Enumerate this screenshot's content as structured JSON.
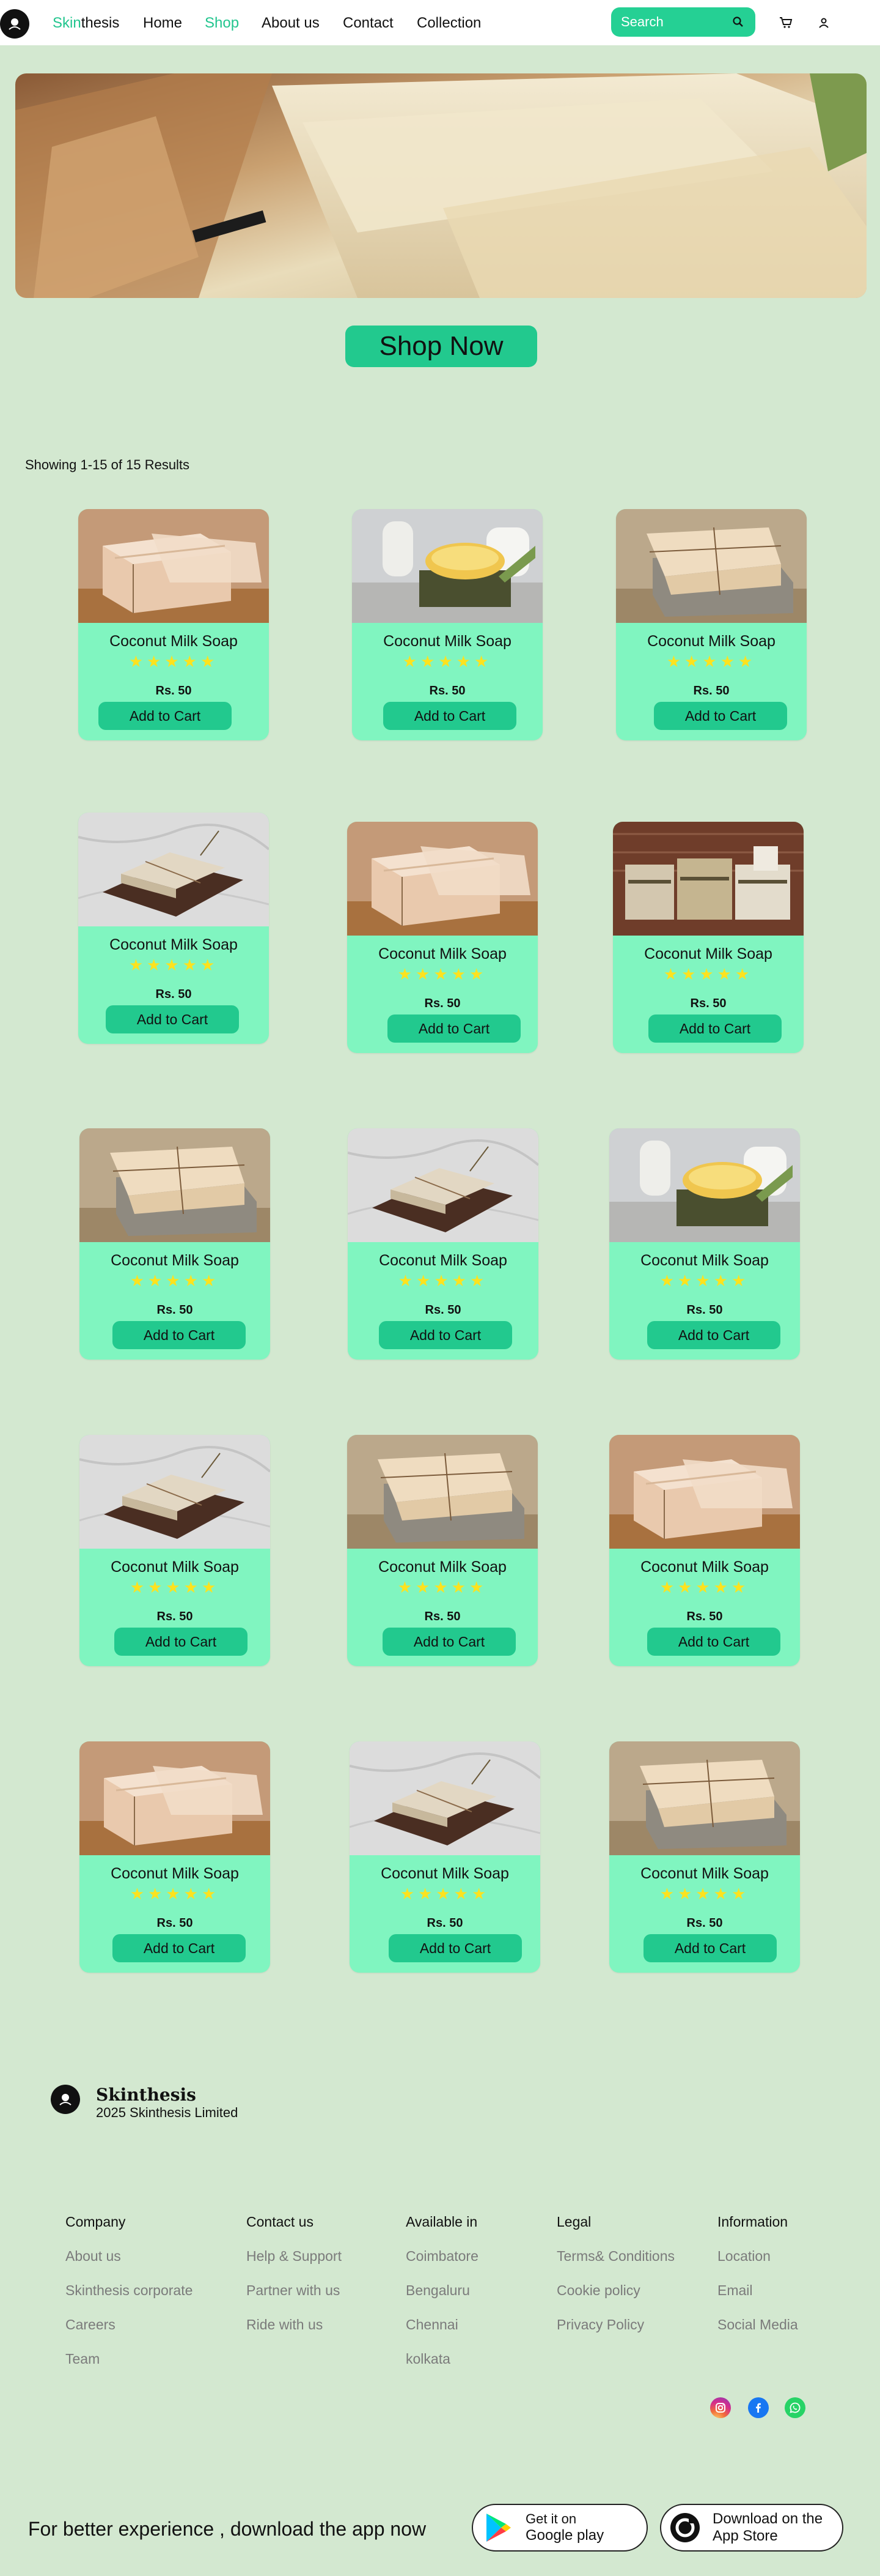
{
  "nav": {
    "brand_part1": "Skin",
    "brand_part2": "thesis",
    "links": [
      "Home",
      "Shop",
      "About us",
      "Contact",
      "Collection"
    ],
    "active": "Shop",
    "search_placeholder": "Search"
  },
  "hero": {
    "cta": "Shop Now"
  },
  "results_text": "Showing 1-15 of 15 Results",
  "products": [
    {
      "title": "Coconut Milk Soap",
      "rating": 5,
      "price": "Rs. 50",
      "button": "Add to Cart"
    },
    {
      "title": "Coconut Milk Soap",
      "rating": 5,
      "price": "Rs. 50",
      "button": "Add to Cart"
    },
    {
      "title": "Coconut Milk Soap",
      "rating": 5,
      "price": "Rs. 50",
      "button": "Add to Cart"
    },
    {
      "title": "Coconut Milk Soap",
      "rating": 5,
      "price": "Rs. 50",
      "button": "Add to Cart"
    },
    {
      "title": "Coconut Milk Soap",
      "rating": 5,
      "price": "Rs. 50",
      "button": "Add to Cart"
    },
    {
      "title": "Coconut Milk Soap",
      "rating": 5,
      "price": "Rs. 50",
      "button": "Add to Cart"
    },
    {
      "title": "Coconut Milk Soap",
      "rating": 5,
      "price": "Rs. 50",
      "button": "Add to Cart"
    },
    {
      "title": "Coconut Milk Soap",
      "rating": 5,
      "price": "Rs. 50",
      "button": "Add to Cart"
    },
    {
      "title": "Coconut Milk Soap",
      "rating": 5,
      "price": "Rs. 50",
      "button": "Add to Cart"
    },
    {
      "title": "Coconut Milk Soap",
      "rating": 5,
      "price": "Rs. 50",
      "button": "Add to Cart"
    },
    {
      "title": "Coconut Milk Soap",
      "rating": 5,
      "price": "Rs. 50",
      "button": "Add to Cart"
    },
    {
      "title": "Coconut Milk Soap",
      "rating": 5,
      "price": "Rs. 50",
      "button": "Add to Cart"
    },
    {
      "title": "Coconut Milk Soap",
      "rating": 5,
      "price": "Rs. 50",
      "button": "Add to Cart"
    },
    {
      "title": "Coconut Milk Soap",
      "rating": 5,
      "price": "Rs. 50",
      "button": "Add to Cart"
    },
    {
      "title": "Coconut Milk Soap",
      "rating": 5,
      "price": "Rs. 50",
      "button": "Add to Cart"
    }
  ],
  "footer": {
    "brand": "Skinthesis",
    "copyright": "2025 Skinthesis Limited",
    "columns": [
      {
        "heading": "Company",
        "items": [
          "About us",
          "Skinthesis corporate",
          "Careers",
          "Team"
        ]
      },
      {
        "heading": "Contact us",
        "items": [
          "Help & Support",
          "Partner with us",
          "Ride with us"
        ]
      },
      {
        "heading": "Available in",
        "items": [
          "Coimbatore",
          "Bengaluru",
          "Chennai",
          "kolkata"
        ]
      },
      {
        "heading": "Legal",
        "items": [
          "Terms& Conditions",
          "Cookie policy",
          "Privacy Policy"
        ]
      },
      {
        "heading": "Information",
        "items": [
          "Location",
          "Email",
          "Social Media"
        ]
      }
    ],
    "social_icons": [
      "instagram-icon",
      "facebook-icon",
      "whatsapp-icon"
    ],
    "download_text": "For better experience , download the app now",
    "google_play": {
      "line1": "Get it on",
      "line2": "Google play"
    },
    "app_store": {
      "line1": "Download on the",
      "line2": "App Store"
    }
  },
  "colors": {
    "background": "#d3e8d0",
    "accent": "#22c98e",
    "card": "#80f5c0",
    "star": "#fde21e"
  }
}
